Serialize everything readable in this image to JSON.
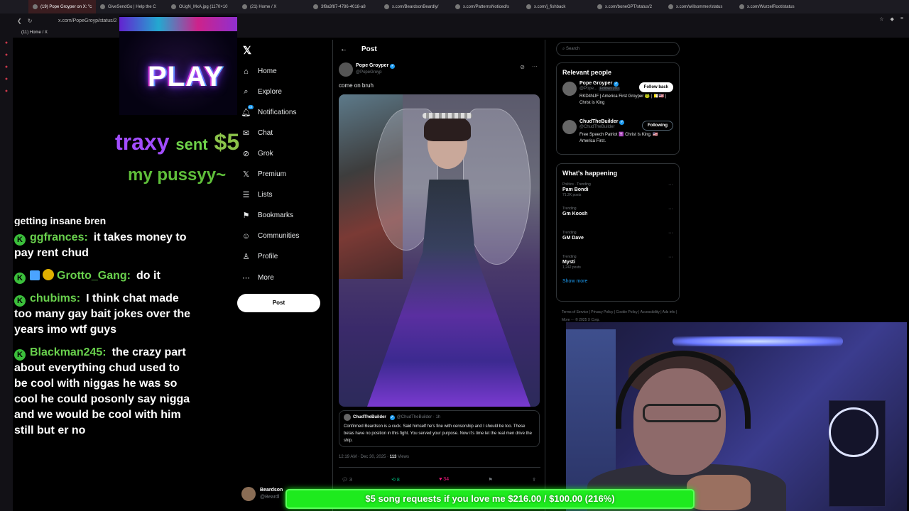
{
  "browser": {
    "tabs": [
      {
        "label": "(19) Pope Groyper on X: \"c",
        "active": true
      },
      {
        "label": "GiveSendGo | Help the C",
        "active": false
      },
      {
        "label": "OUgN_MxA.jpg (1170×10",
        "active": false
      },
      {
        "label": "(21) Home / X",
        "active": false
      },
      {
        "label": "3f8a3f87-4786-4018-a8",
        "active": false
      },
      {
        "label": "x.com/BeardsonBeardly/",
        "active": false
      },
      {
        "label": "x.com/PatternsNoticed/s",
        "active": false
      },
      {
        "label": "x.com/j_fishback",
        "active": false
      },
      {
        "label": "x.com/boneGPT/status/2",
        "active": false
      },
      {
        "label": "x.com/willsommer/status",
        "active": false
      },
      {
        "label": "x.com/WurzelRoot/status",
        "active": false
      }
    ],
    "url": "x.com/PopeGroyp/status/2",
    "bookmark": "(11) Home / X"
  },
  "overlay": {
    "play": "PLAY",
    "alert_user": "traxy",
    "alert_sent": "sent",
    "alert_amount": "$5",
    "alert_message": "my pussyy~"
  },
  "chat": {
    "clipped": "getting insane bren",
    "messages": [
      {
        "user": "ggfrances:",
        "text": "it takes money to pay rent chud"
      },
      {
        "user": "Grotto_Gang:",
        "text": "do it"
      },
      {
        "user": "chubims:",
        "text": "I think chat made too many gay bait jokes over the years imo wtf guys"
      },
      {
        "user": "Blackman245:",
        "text": "the crazy part about everything chud used to be cool with niggas he was so cool he could posonly say nigga and we would be cool with him still but er no"
      }
    ]
  },
  "xnav": {
    "items": [
      {
        "label": "Home",
        "icon": "home-icon"
      },
      {
        "label": "Explore",
        "icon": "search-icon"
      },
      {
        "label": "Notifications",
        "icon": "bell-icon"
      },
      {
        "label": "Chat",
        "icon": "mail-icon"
      },
      {
        "label": "Grok",
        "icon": "grok-icon"
      },
      {
        "label": "Premium",
        "icon": "x-icon"
      },
      {
        "label": "Lists",
        "icon": "list-icon"
      },
      {
        "label": "Bookmarks",
        "icon": "bookmark-icon"
      },
      {
        "label": "Communities",
        "icon": "people-icon"
      },
      {
        "label": "Profile",
        "icon": "person-icon"
      },
      {
        "label": "More",
        "icon": "more-circle-icon"
      }
    ],
    "notifications_badge": "19",
    "post_button": "Post",
    "account_name": "Beardson",
    "account_handle": "@Beardl"
  },
  "post": {
    "header": "Post",
    "author_name": "Pope Groyper",
    "author_handle": "@PopeGroyp",
    "text": "come on bruh",
    "quote": {
      "name": "ChudTheBuilder",
      "handle_time": "@ChudTheBuilder · 1h",
      "text": "Confirmed Beardson is a cuck. Said himself he's fine with censorship and I should be too. These betas have no position in this fight. You served your purpose. Now it's time let the real men drive the ship."
    },
    "timestamp": "12:19 AM · Dec 30, 2025 · ",
    "views_count": "113",
    "views_label": " Views",
    "replies": "3",
    "reposts": "8",
    "likes": "34"
  },
  "sidebar": {
    "search_placeholder": "Search",
    "relevant_title": "Relevant people",
    "people": [
      {
        "name": "Pope Groyper",
        "handle": "@Pope...",
        "follows_you": "Follows you",
        "bio": "RKD4NJF | America First Groyper 🐸 | 🇻🇦🇺🇸 | Christ is King",
        "button": "Follow back",
        "style": "white"
      },
      {
        "name": "ChudTheBuilder",
        "handle": "@ChudTheBuilder",
        "follows_you": "",
        "bio": "Free Speech Patriot ✝️ Christ Is King. 🇺🇸 America First.",
        "button": "Following",
        "style": "outline"
      }
    ],
    "happening_title": "What's happening",
    "trends": [
      {
        "meta": "Politics · Trending",
        "name": "Pam Bondi",
        "posts": "71.2K posts"
      },
      {
        "meta": "Trending",
        "name": "Gm Koosh",
        "posts": ""
      },
      {
        "meta": "Trending",
        "name": "GM Dave",
        "posts": ""
      },
      {
        "meta": "Trending",
        "name": "Mysti",
        "posts": "1,242 posts"
      }
    ],
    "show_more": "Show more",
    "footer": "Terms of Service | Privacy Policy | Cookie Policy | Accessibility | Ads info | More ··· © 2025 X Corp."
  },
  "donation_bar": {
    "text": "$5 song requests if you love me $216.00 / $100.00 (216%)",
    "progress_percent": 216
  },
  "colors": {
    "accent": "#1d9bf0",
    "goal_green": "#1eea1e",
    "chat_user": "#69d14d"
  }
}
